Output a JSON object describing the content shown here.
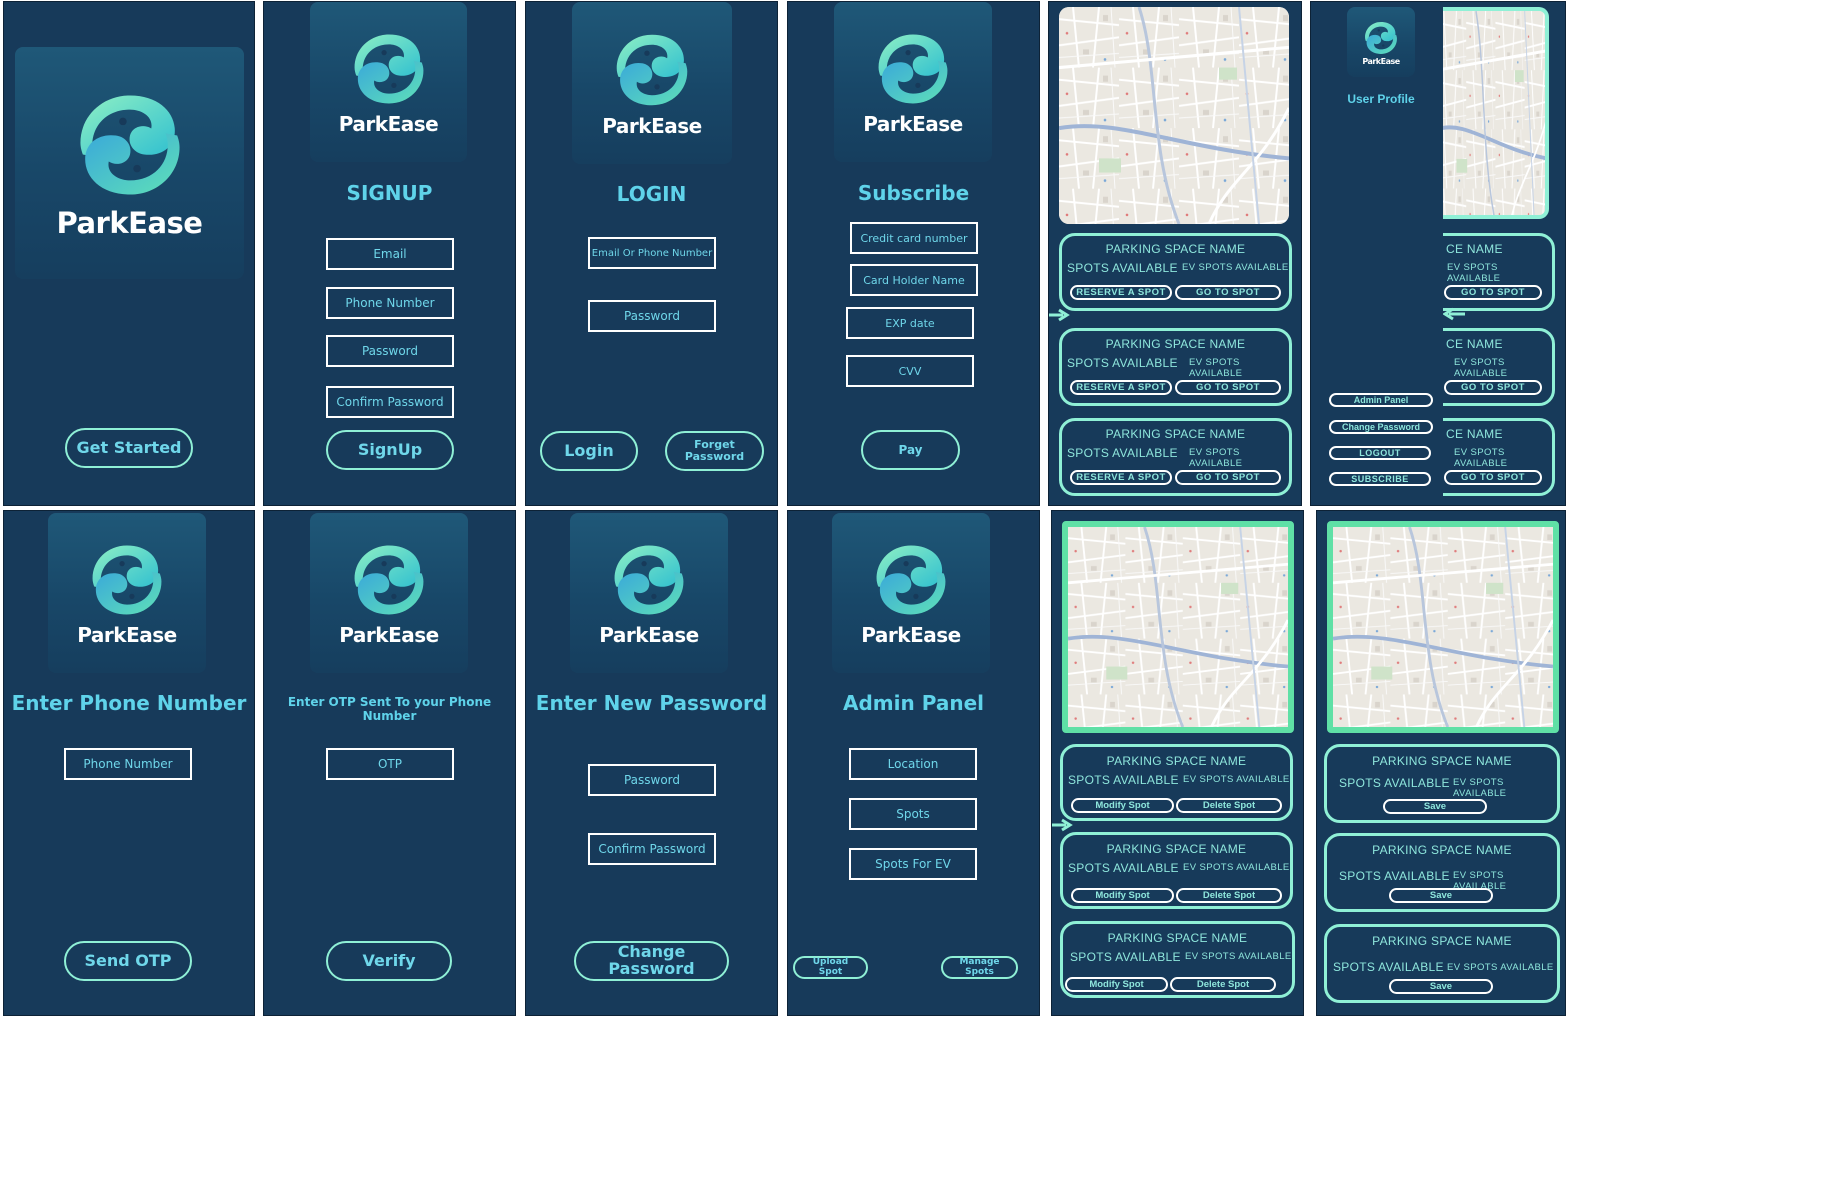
{
  "brand": "ParkEase",
  "colors": {
    "panel_bg": "#173a5a",
    "accent": "#5fd3ea",
    "button_border": "#8ff0d6",
    "card_border": "#8ff0d6",
    "field_border": "#ffffff"
  },
  "splash": {
    "button": "Get Started"
  },
  "signup": {
    "title": "SIGNUP",
    "email": "Email",
    "phone": "Phone Number",
    "password": "Password",
    "confirm": "Confirm Password",
    "button": "SignUp"
  },
  "login": {
    "title": "LOGIN",
    "id_field": "Email Or Phone Number",
    "password": "Password",
    "login_button": "Login",
    "forget_button": "Forget Password"
  },
  "subscribe": {
    "title": "Subscribe",
    "card_number": "Credit card number",
    "holder": "Card Holder Name",
    "exp": "EXP date",
    "cvv": "CVV",
    "pay": "Pay"
  },
  "spots": {
    "name": "PARKING SPACE NAME",
    "available": "SPOTS AVAILABLE",
    "ev": "EV SPOTS AVAILABLE",
    "reserve": "RESERVE A SPOT",
    "goto": "GO TO SPOT"
  },
  "profile": {
    "title": "User Profile",
    "name_partial": "CE NAME",
    "admin": "Admin Panel",
    "change_pw": "Change Password",
    "logout": "LOGOUT",
    "subscribe": "SUBSCRIBE"
  },
  "phone": {
    "title": "Enter Phone Number",
    "field": "Phone Number",
    "button": "Send OTP"
  },
  "otp": {
    "title": "Enter OTP Sent To your Phone Number",
    "field": "OTP",
    "button": "Verify"
  },
  "newpw": {
    "title": "Enter New Password",
    "password": "Password",
    "confirm": "Confirm Password",
    "button": "Change Password"
  },
  "admin": {
    "title": "Admin Panel",
    "location": "Location",
    "spots": "Spots",
    "ev": "Spots For EV",
    "upload": "Upload Spot",
    "manage": "Manage Spots"
  },
  "manage": {
    "modify": "Modify Spot",
    "delete": "Delete Spot",
    "save": "Save"
  }
}
